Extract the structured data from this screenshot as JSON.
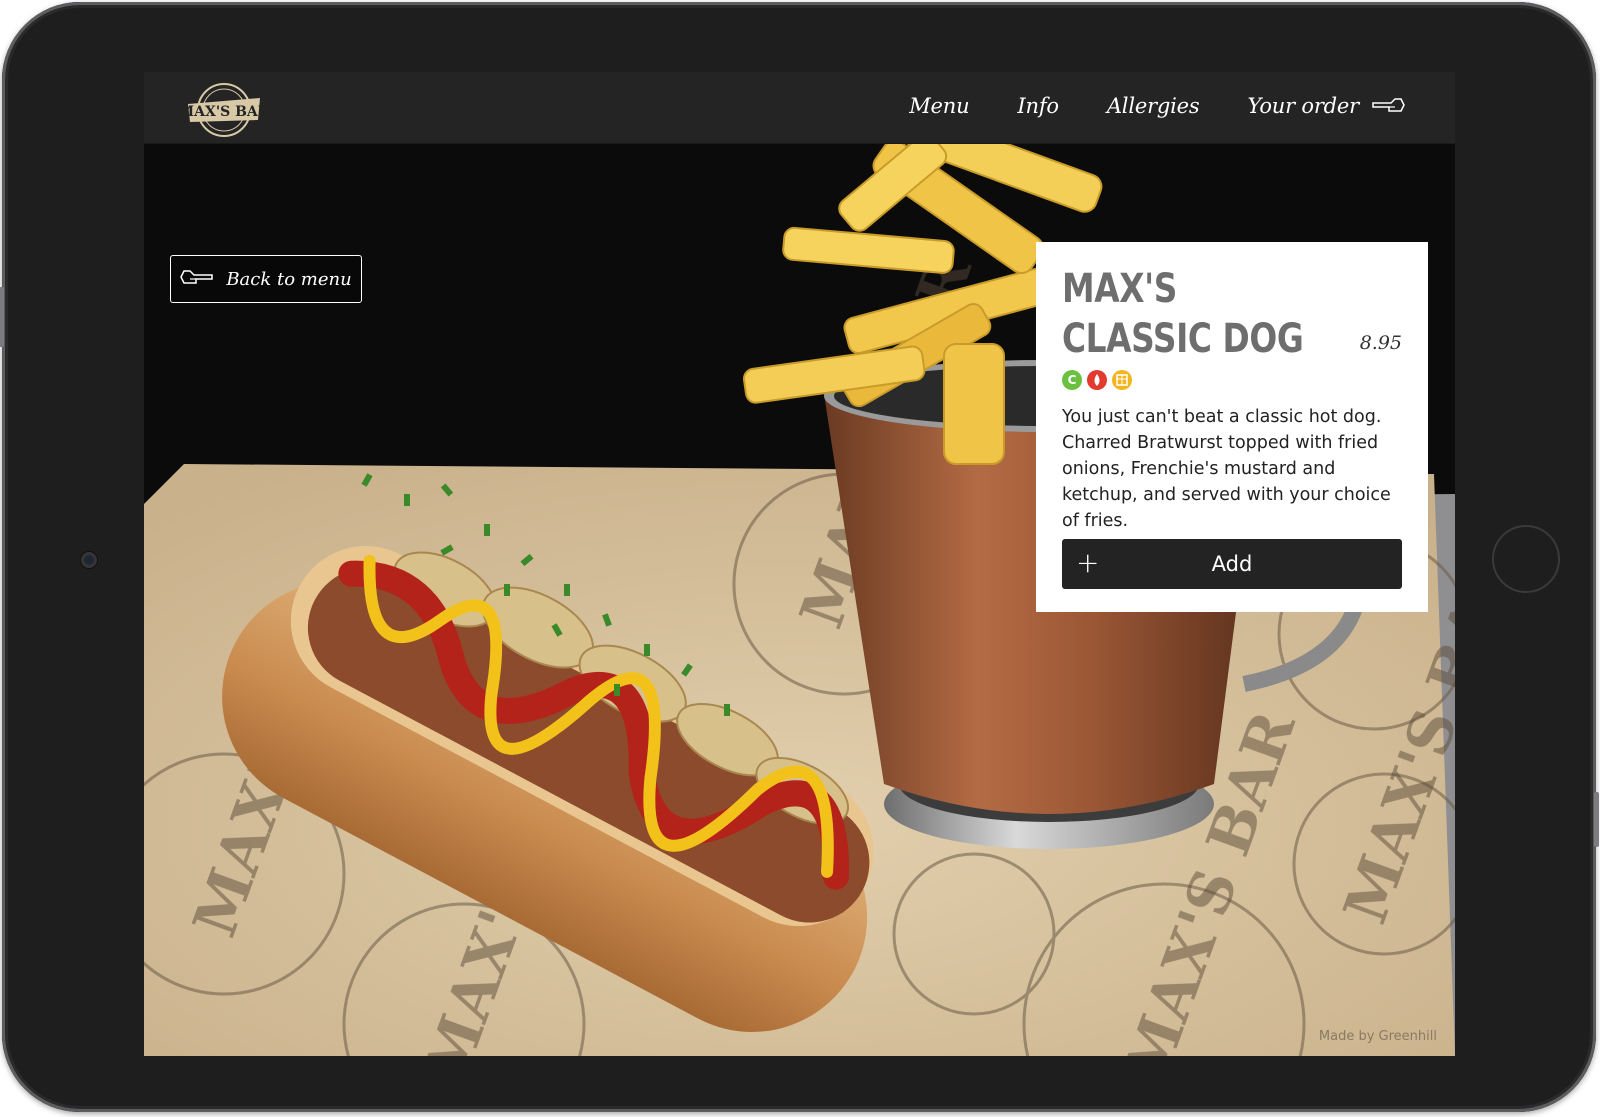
{
  "nav": {
    "logo_text": "Max's Bar",
    "items": [
      {
        "label": "Menu"
      },
      {
        "label": "Info"
      },
      {
        "label": "Allergies"
      },
      {
        "label": "Your order",
        "icon": "pointing-hand-icon"
      }
    ]
  },
  "back_button": {
    "label": "Back to menu",
    "icon": "pointing-hand-left-icon"
  },
  "product": {
    "title": "MAX'S CLASSIC DOG",
    "price": "8.95",
    "badges": [
      {
        "icon": "c-badge-icon",
        "letter": "C",
        "color": "#6cc040"
      },
      {
        "icon": "drop-badge-icon",
        "letter": "●",
        "color": "#e23a2e"
      },
      {
        "icon": "grain-badge-icon",
        "letter": "▦",
        "color": "#f1b520"
      }
    ],
    "description": "You just can't beat a classic hot dog. Charred Bratwurst topped with fried onions, Frenchie's mustard and ketchup, and served with your choice of fries.",
    "add_label": "Add",
    "add_icon": "plus-icon"
  },
  "credit": "Made by Greenhill",
  "colors": {
    "frame": "#1e1e1f",
    "topbar": "#242424",
    "button": "#232323",
    "title": "#6e6e6e"
  }
}
